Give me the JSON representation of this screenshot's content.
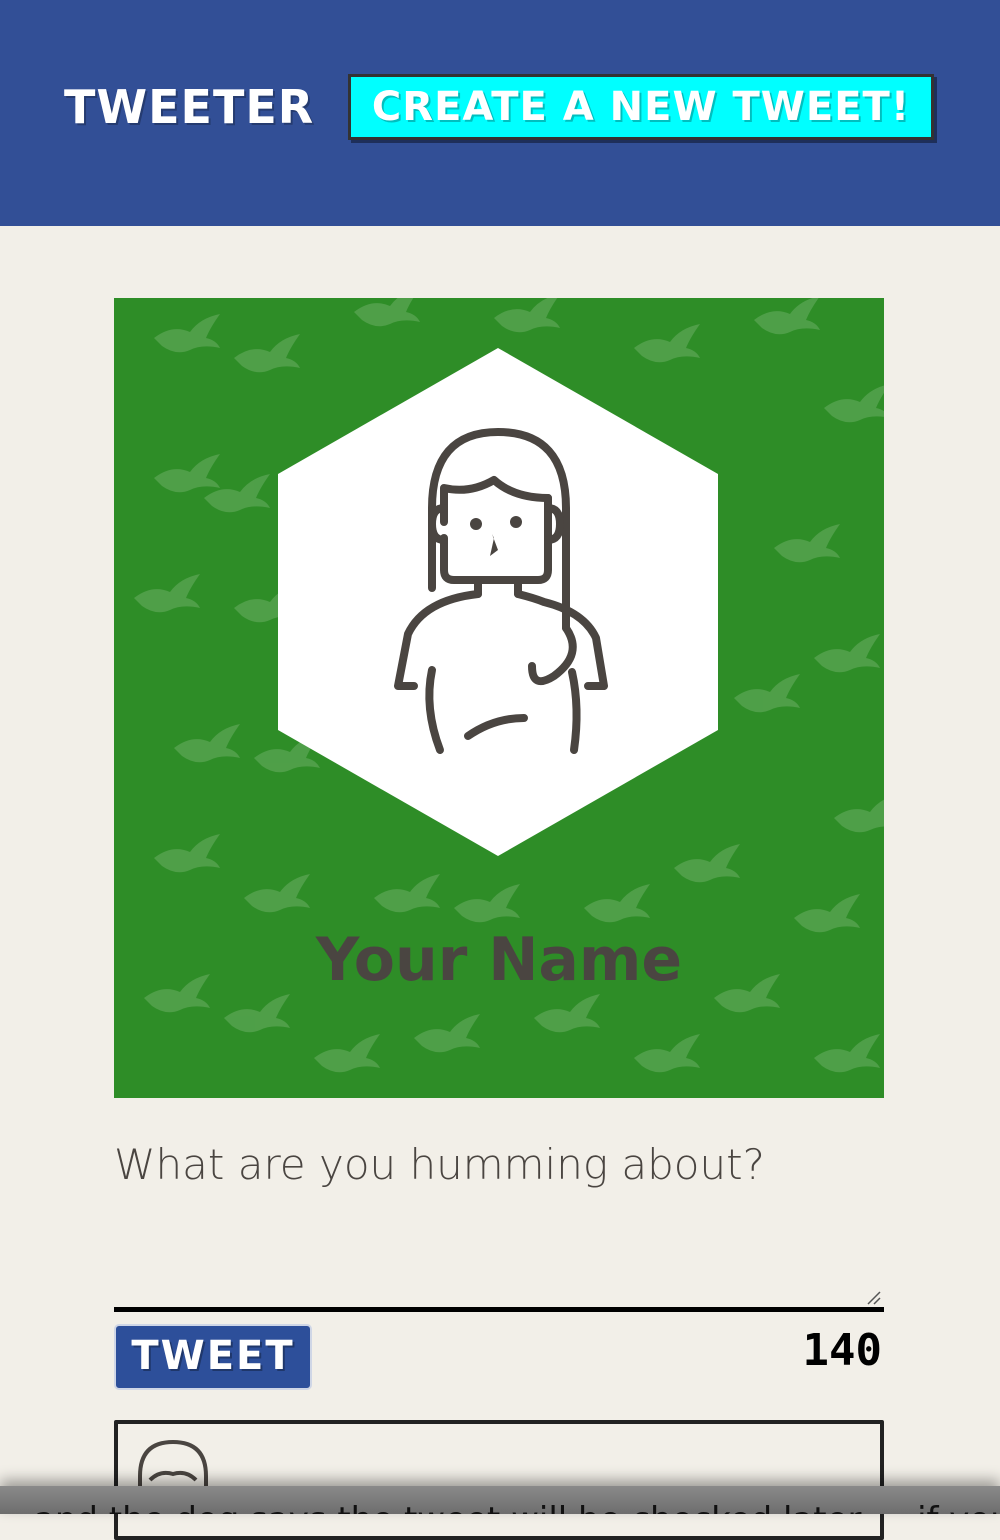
{
  "header": {
    "brand": "TWEETER",
    "new_tweet_label": "CREATE A NEW TWEET!",
    "background_color": "#324f96",
    "button_color": "#00ffff"
  },
  "profile": {
    "name": "Your Name",
    "avatar_icon": "woman-avatar-icon",
    "background_color": "#2e8d27"
  },
  "composer": {
    "placeholder": "What are you humming about?",
    "value": "",
    "tweet_label": "TWEET",
    "char_count": "140"
  },
  "preview": {
    "avatar_icon": "user-avatar-icon"
  },
  "footer_text": "…and the dog says the tweet will be checked later … if you tweet the …"
}
